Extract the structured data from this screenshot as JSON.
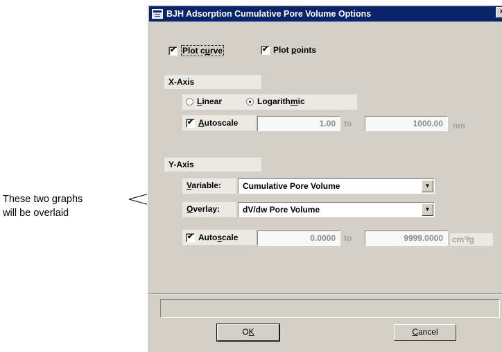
{
  "callout": {
    "line1": "These two graphs",
    "line2": "will be overlaid"
  },
  "dialog": {
    "title": "BJH Adsorption Cumulative Pore Volume Options",
    "close": "×",
    "plot_curve": {
      "before": "Plot c",
      "hot": "u",
      "after": "rve",
      "checked": true
    },
    "plot_points": {
      "before": "Plot ",
      "hot": "p",
      "after": "oints",
      "checked": true
    },
    "x_axis": {
      "heading": "X-Axis",
      "linear": {
        "hot": "L",
        "after": "inear",
        "selected": false
      },
      "logarithmic": {
        "before": "Logarith",
        "hot": "m",
        "after": "ic",
        "selected": true
      },
      "autoscale": {
        "hot": "A",
        "after": "utoscale",
        "checked": true
      },
      "from": "1.00",
      "to_label": "to",
      "to": "1000.00",
      "unit": "nm"
    },
    "y_axis": {
      "heading": "Y-Axis",
      "variable_label": {
        "hot": "V",
        "after": "ariable:"
      },
      "variable": "Cumulative Pore Volume",
      "overlay_label": {
        "hot": "O",
        "after": "verlay:"
      },
      "overlay": "dV/dw Pore Volume",
      "autoscale": {
        "before": "Auto",
        "hot": "s",
        "after": "cale",
        "checked": true
      },
      "from": "0.0000",
      "to_label": "to",
      "to": "9999.0000",
      "unit": "cm³/g"
    },
    "ok": {
      "before": "O",
      "hot": "K",
      "after": ""
    },
    "cancel": {
      "before": "",
      "hot": "C",
      "after": "ancel"
    }
  }
}
